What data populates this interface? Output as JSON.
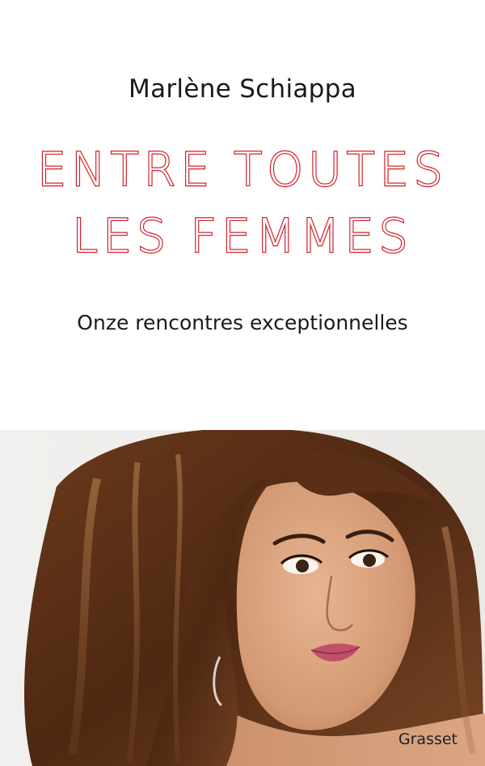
{
  "cover": {
    "author": "Marlène Schiappa",
    "title_line1": "ENTRE TOUTES",
    "title_line2": "LES FEMMES",
    "subtitle": "Onze rencontres exceptionnelles",
    "publisher": "Grasset"
  },
  "colors": {
    "title_outline": "#d2202a",
    "background": "#ffffff",
    "hair": "#5a2f17",
    "skin": "#d9a27e",
    "lips": "#c0506a"
  }
}
